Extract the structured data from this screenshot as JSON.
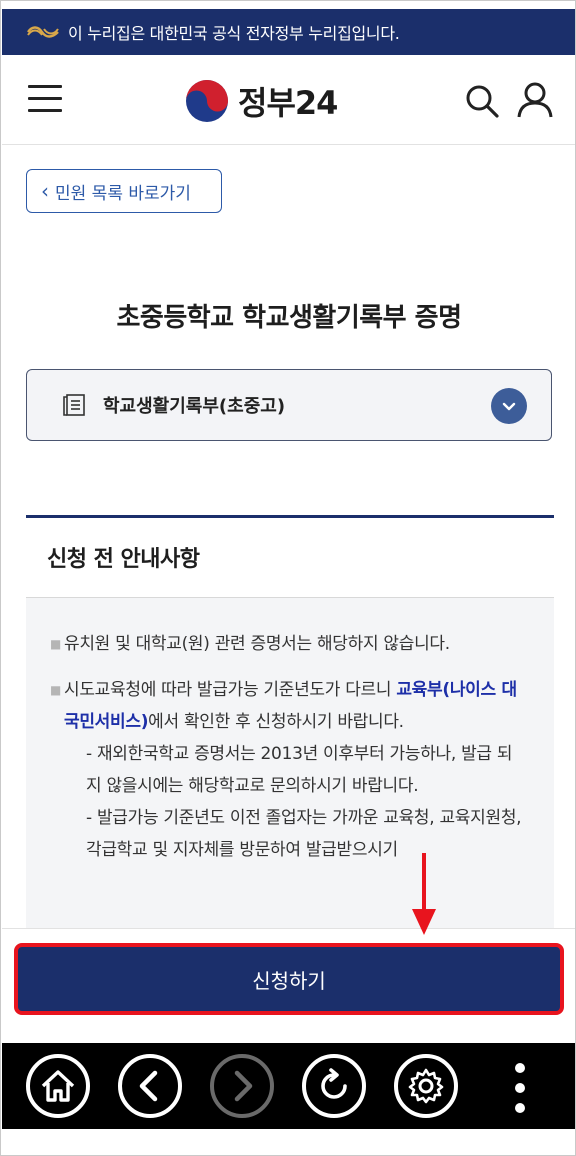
{
  "gov_banner": {
    "text": "이 누리집은 대한민국 공식 전자정부 누리집입니다."
  },
  "header": {
    "logo_text": "정부24"
  },
  "back_link": {
    "label": "민원 목록 바로가기"
  },
  "page": {
    "title": "초중등학교 학교생활기록부 증명"
  },
  "doc_select": {
    "selected": "학교생활기록부(초중고)"
  },
  "notice": {
    "title": "신청 전 안내사항",
    "item1": "유치원 및 대학교(원) 관련 증명서는 해당하지 않습니다.",
    "item2_pre": "시도교육청에 따라 발급가능 기준년도가 다르니 ",
    "item2_link": "교육부(나이스 대국민서비스)",
    "item2_post": "에서 확인한 후 신청하시기 바랍니다.",
    "sub1": "- 재외한국학교 증명서는 2013년 이후부터 가능하나, 발급 되지 않을시에는 해당학교로 문의하시기 바랍니다.",
    "sub2": "- 발급가능 기준년도 이전 졸업자는 가까운 교육청, 교육지원청, 각급학교 및 지자체를 방문하여 발급받으시기"
  },
  "apply_button": {
    "label": "신청하기"
  },
  "colors": {
    "navy": "#1b2f6b",
    "accent_blue": "#2d5aa8",
    "highlight_red": "#e8141e",
    "link": "#1d2fa8"
  }
}
